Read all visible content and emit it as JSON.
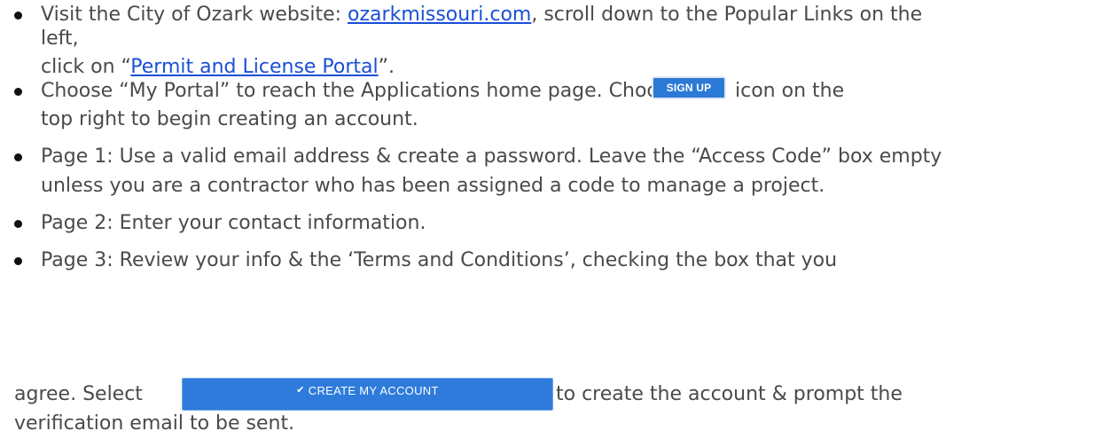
{
  "bullets": [
    {
      "lines": [
        {
          "prefix": "Visit the City of Ozark website: ",
          "link": "ozarkmissouri.com",
          "suffix": ", scroll down to the Popular Links on the"
        },
        {
          "text": "left,"
        },
        {
          "prefix": "click on “",
          "link": "Permit and License Portal",
          "suffix": "”."
        }
      ]
    },
    {
      "lines": [
        {
          "prefix": "Choose “My Portal” to reach the Applications home page. Choose",
          "suffix": "icon on the"
        },
        {
          "text": "top right to begin creating an account."
        }
      ]
    },
    {
      "lines": [
        {
          "text": "Page 1: Use a valid email address & create a password. Leave the “Access Code” box empty"
        },
        {
          "text": "unless you are a contractor who has been assigned a code to manage a project."
        }
      ]
    },
    {
      "lines": [
        {
          "text": "Page 2: Enter your contact information."
        }
      ]
    },
    {
      "lines": [
        {
          "text": "Page 3: Review your info & the ‘Terms and Conditions’, checking the box that you"
        }
      ]
    }
  ],
  "continuation": {
    "prefix": "agree. Select",
    "suffix": "to create the account & prompt the",
    "line2": "verification email to be sent."
  },
  "buttons": {
    "sign_up": "SIGN UP",
    "create_account": "CREATE MY ACCOUNT",
    "create_account_icon": "check-icon"
  },
  "colors": {
    "link": "#1a4fd6",
    "button": "#2e7bdc"
  }
}
